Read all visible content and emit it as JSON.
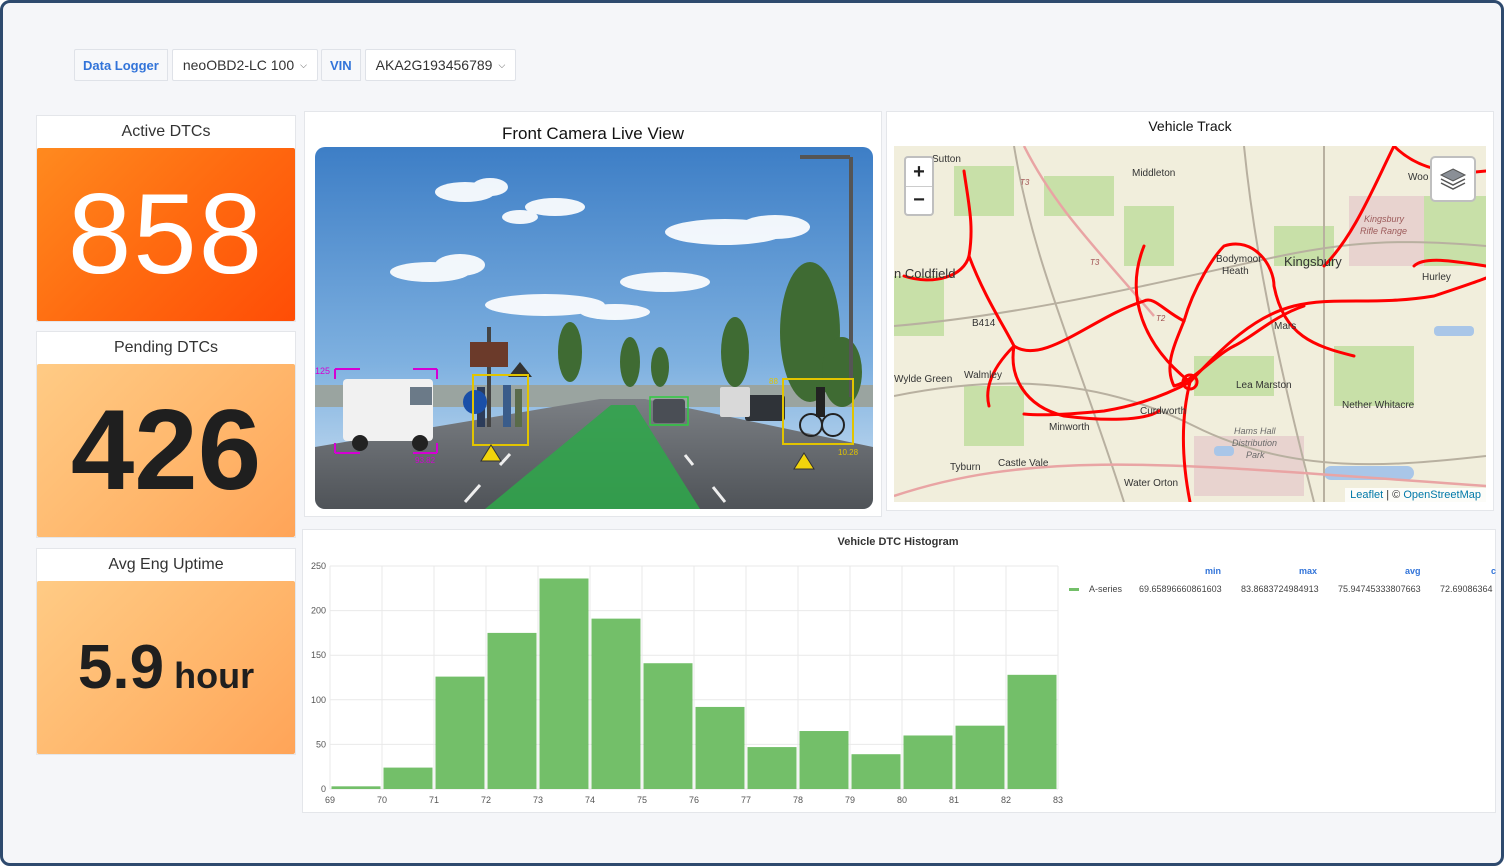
{
  "variables": [
    {
      "label": "Data Logger",
      "value": "neoOBD2-LC 100"
    },
    {
      "label": "VIN",
      "value": "AKA2G193456789"
    }
  ],
  "stats": {
    "active": {
      "title": "Active DTCs",
      "value": "858"
    },
    "pending": {
      "title": "Pending DTCs",
      "value": "426"
    },
    "uptime": {
      "title": "Avg Eng Uptime",
      "value": "5.9",
      "unit": "hour"
    }
  },
  "camera": {
    "title": "Front Camera Live View",
    "detections": [
      "125",
      "93.82",
      "88",
      "10.28"
    ]
  },
  "map": {
    "title": "Vehicle Track",
    "zoom_in": "+",
    "zoom_out": "−",
    "attribution_leaflet": "Leaflet",
    "attribution_sep": " | © ",
    "attribution_osm": "OpenStreetMap",
    "places": {
      "sutton": "Sutton",
      "middleton": "Middleton",
      "woo": "Woo",
      "coldfield": "n Coldfield",
      "bodymoor": "Bodymoor",
      "heath": "Heath",
      "kingsbury": "Kingsbury",
      "rifle1": "Kingsbury",
      "rifle2": "Rifle Range",
      "hurley": "Hurley",
      "b4148": "B414",
      "mars": "Mars",
      "wylde": "Wylde Green",
      "walmley": "Walmley",
      "lea": "Lea Marston",
      "nether": "Nether Whitacre",
      "curdworth": "Curdworth",
      "minworth": "Minworth",
      "hams1": "Hams Hall",
      "hams2": "Distribution",
      "hams3": "Park",
      "tyburn": "Tyburn",
      "castle": "Castle Vale",
      "water": "Water Orton",
      "t3a": "T3",
      "t3b": "T3",
      "t2": "T2"
    }
  },
  "histogram": {
    "title": "Vehicle DTC Histogram",
    "legend": {
      "headers": [
        "min",
        "max",
        "avg",
        "c"
      ],
      "series_name": "A-series",
      "min": "69.65896660861603",
      "max": "83.8683724984913",
      "avg": "75.94745333807663",
      "current": "72.69086364"
    }
  },
  "chart_data": {
    "type": "bar",
    "title": "Vehicle DTC Histogram",
    "x_ticks": [
      69,
      70,
      71,
      72,
      73,
      74,
      75,
      76,
      77,
      78,
      79,
      80,
      81,
      82,
      83
    ],
    "bins": [
      {
        "x0": 69,
        "x1": 70,
        "value": 3
      },
      {
        "x0": 70,
        "x1": 71,
        "value": 24
      },
      {
        "x0": 71,
        "x1": 72,
        "value": 126
      },
      {
        "x0": 72,
        "x1": 73,
        "value": 175
      },
      {
        "x0": 73,
        "x1": 74,
        "value": 236
      },
      {
        "x0": 74,
        "x1": 75,
        "value": 191
      },
      {
        "x0": 75,
        "x1": 76,
        "value": 141
      },
      {
        "x0": 76,
        "x1": 77,
        "value": 92
      },
      {
        "x0": 77,
        "x1": 78,
        "value": 47
      },
      {
        "x0": 78,
        "x1": 79,
        "value": 65
      },
      {
        "x0": 79,
        "x1": 80,
        "value": 39
      },
      {
        "x0": 80,
        "x1": 81,
        "value": 60
      },
      {
        "x0": 81,
        "x1": 82,
        "value": 71
      },
      {
        "x0": 82,
        "x1": 83,
        "value": 128
      }
    ],
    "y_ticks": [
      0,
      50,
      100,
      150,
      200,
      250
    ],
    "ylim": [
      0,
      250
    ],
    "xlim": [
      69,
      83
    ],
    "grid": true,
    "color": "#73bf69",
    "legend_position": "right"
  }
}
